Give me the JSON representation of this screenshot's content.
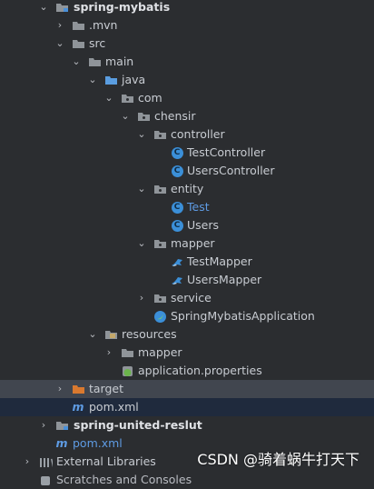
{
  "project_tree": {
    "root": "spring-mybatis",
    "mvn": ".mvn",
    "src": "src",
    "main": "main",
    "java": "java",
    "com": "com",
    "chensir": "chensir",
    "controller": "controller",
    "test_controller": "TestController",
    "users_controller": "UsersController",
    "entity": "entity",
    "test": "Test",
    "users": "Users",
    "mapper": "mapper",
    "test_mapper": "TestMapper",
    "users_mapper": "UsersMapper",
    "service": "service",
    "app_class": "SpringMybatisApplication",
    "resources": "resources",
    "resources_mapper": "mapper",
    "application_properties": "application.properties",
    "target": "target",
    "pom": "pom.xml",
    "second_project": "spring-united-reslut",
    "root_pom": "pom.xml",
    "external_libraries": "External Libraries",
    "scratches": "Scratches and Consoles"
  },
  "watermark": "CSDN @骑着蜗牛打天下",
  "colors": {
    "background": "#2b2d30",
    "selected_row": "#41464f",
    "pom_row": "#1f2a3d",
    "folder": "#8f9499",
    "source_folder": "#5a9de0",
    "target_folder": "#d9792f",
    "class_icon": "#3b8fd8",
    "maven_blue": "#5e9be3"
  },
  "icons": {
    "expand": "chevron-down-icon",
    "collapse": "chevron-right-icon",
    "folder": "folder-icon",
    "class": "class-c-icon",
    "mapper": "mapper-bird-icon",
    "spring_app": "spring-app-icon",
    "properties": "spring-properties-icon",
    "maven": "maven-m-icon",
    "library": "library-icon"
  }
}
